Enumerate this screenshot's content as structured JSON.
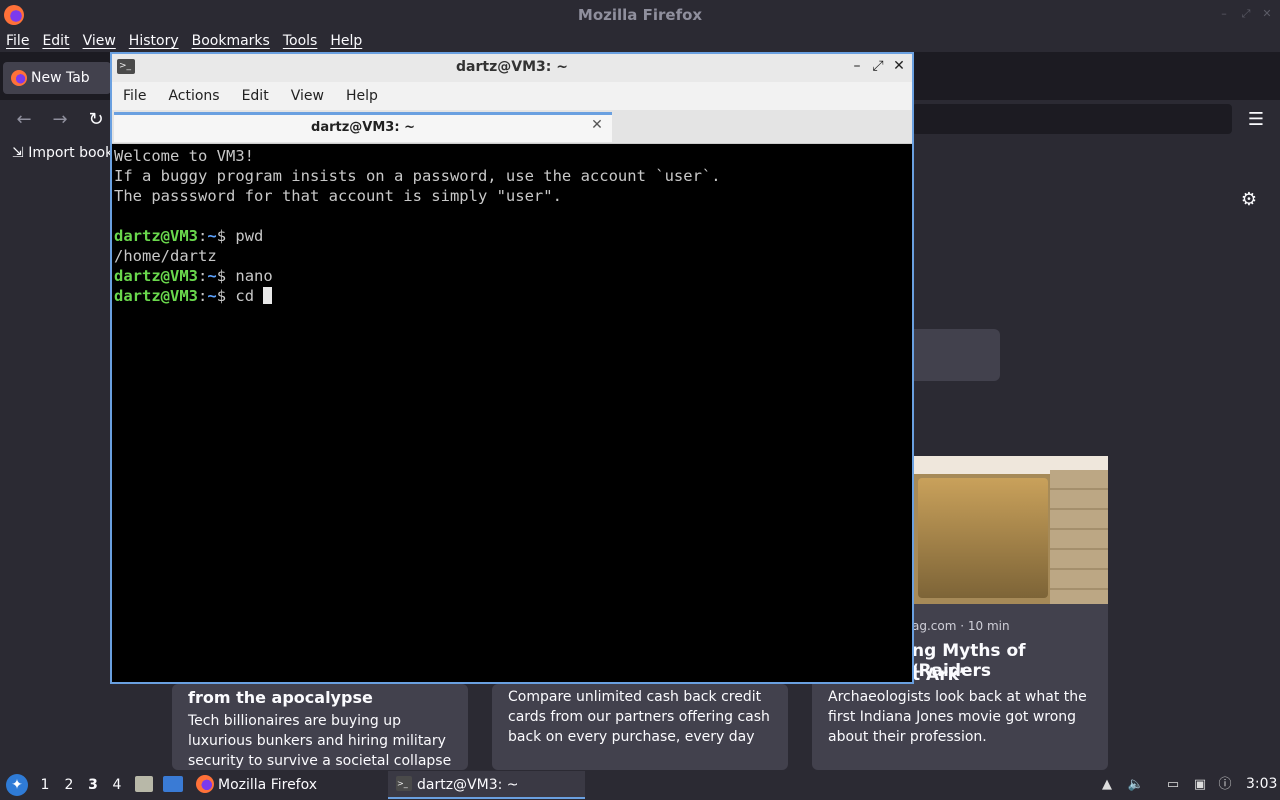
{
  "firefox": {
    "title": "Mozilla Firefox",
    "menu": [
      "File",
      "Edit",
      "View",
      "History",
      "Bookmarks",
      "Tools",
      "Help"
    ],
    "tab_label": "New Tab",
    "bookmarks_label": "Import book",
    "cards": [
      {
        "title": "from the apocalypse",
        "text": "Tech billionaires are buying up luxurious bunkers and hiring military security to survive a societal collapse they helped…"
      },
      {
        "text": "Compare unlimited cash back credit cards from our partners offering cash back on every purchase, every day"
      },
      {
        "meta": "ag.com · 10 min",
        "title_line1": "ng Myths of ‘Raiders",
        "title_line2": "t Ark’",
        "text": "Archaeologists look back at what the first Indiana Jones movie got wrong about their profession."
      }
    ]
  },
  "terminal": {
    "title": "dartz@VM3: ~",
    "menu": [
      "File",
      "Actions",
      "Edit",
      "View",
      "Help"
    ],
    "tab_label": "dartz@VM3: ~",
    "lines": {
      "l1": "Welcome to VM3!",
      "l2": "If a buggy program insists on a password, use the account `user`.",
      "l3": "The passsword for that account is simply \"user\".",
      "p_user": "dartz@VM3",
      "p_sep": ":",
      "p_path": "~",
      "p_dollar": "$ ",
      "cmd1": "pwd",
      "out1": "/home/dartz",
      "cmd2": "nano",
      "cmd3": "cd "
    }
  },
  "taskbar": {
    "workspaces": [
      "1",
      "2",
      "3",
      "4"
    ],
    "tasks": [
      "Mozilla Firefox",
      "dartz@VM3: ~"
    ],
    "clock": "3:03"
  }
}
